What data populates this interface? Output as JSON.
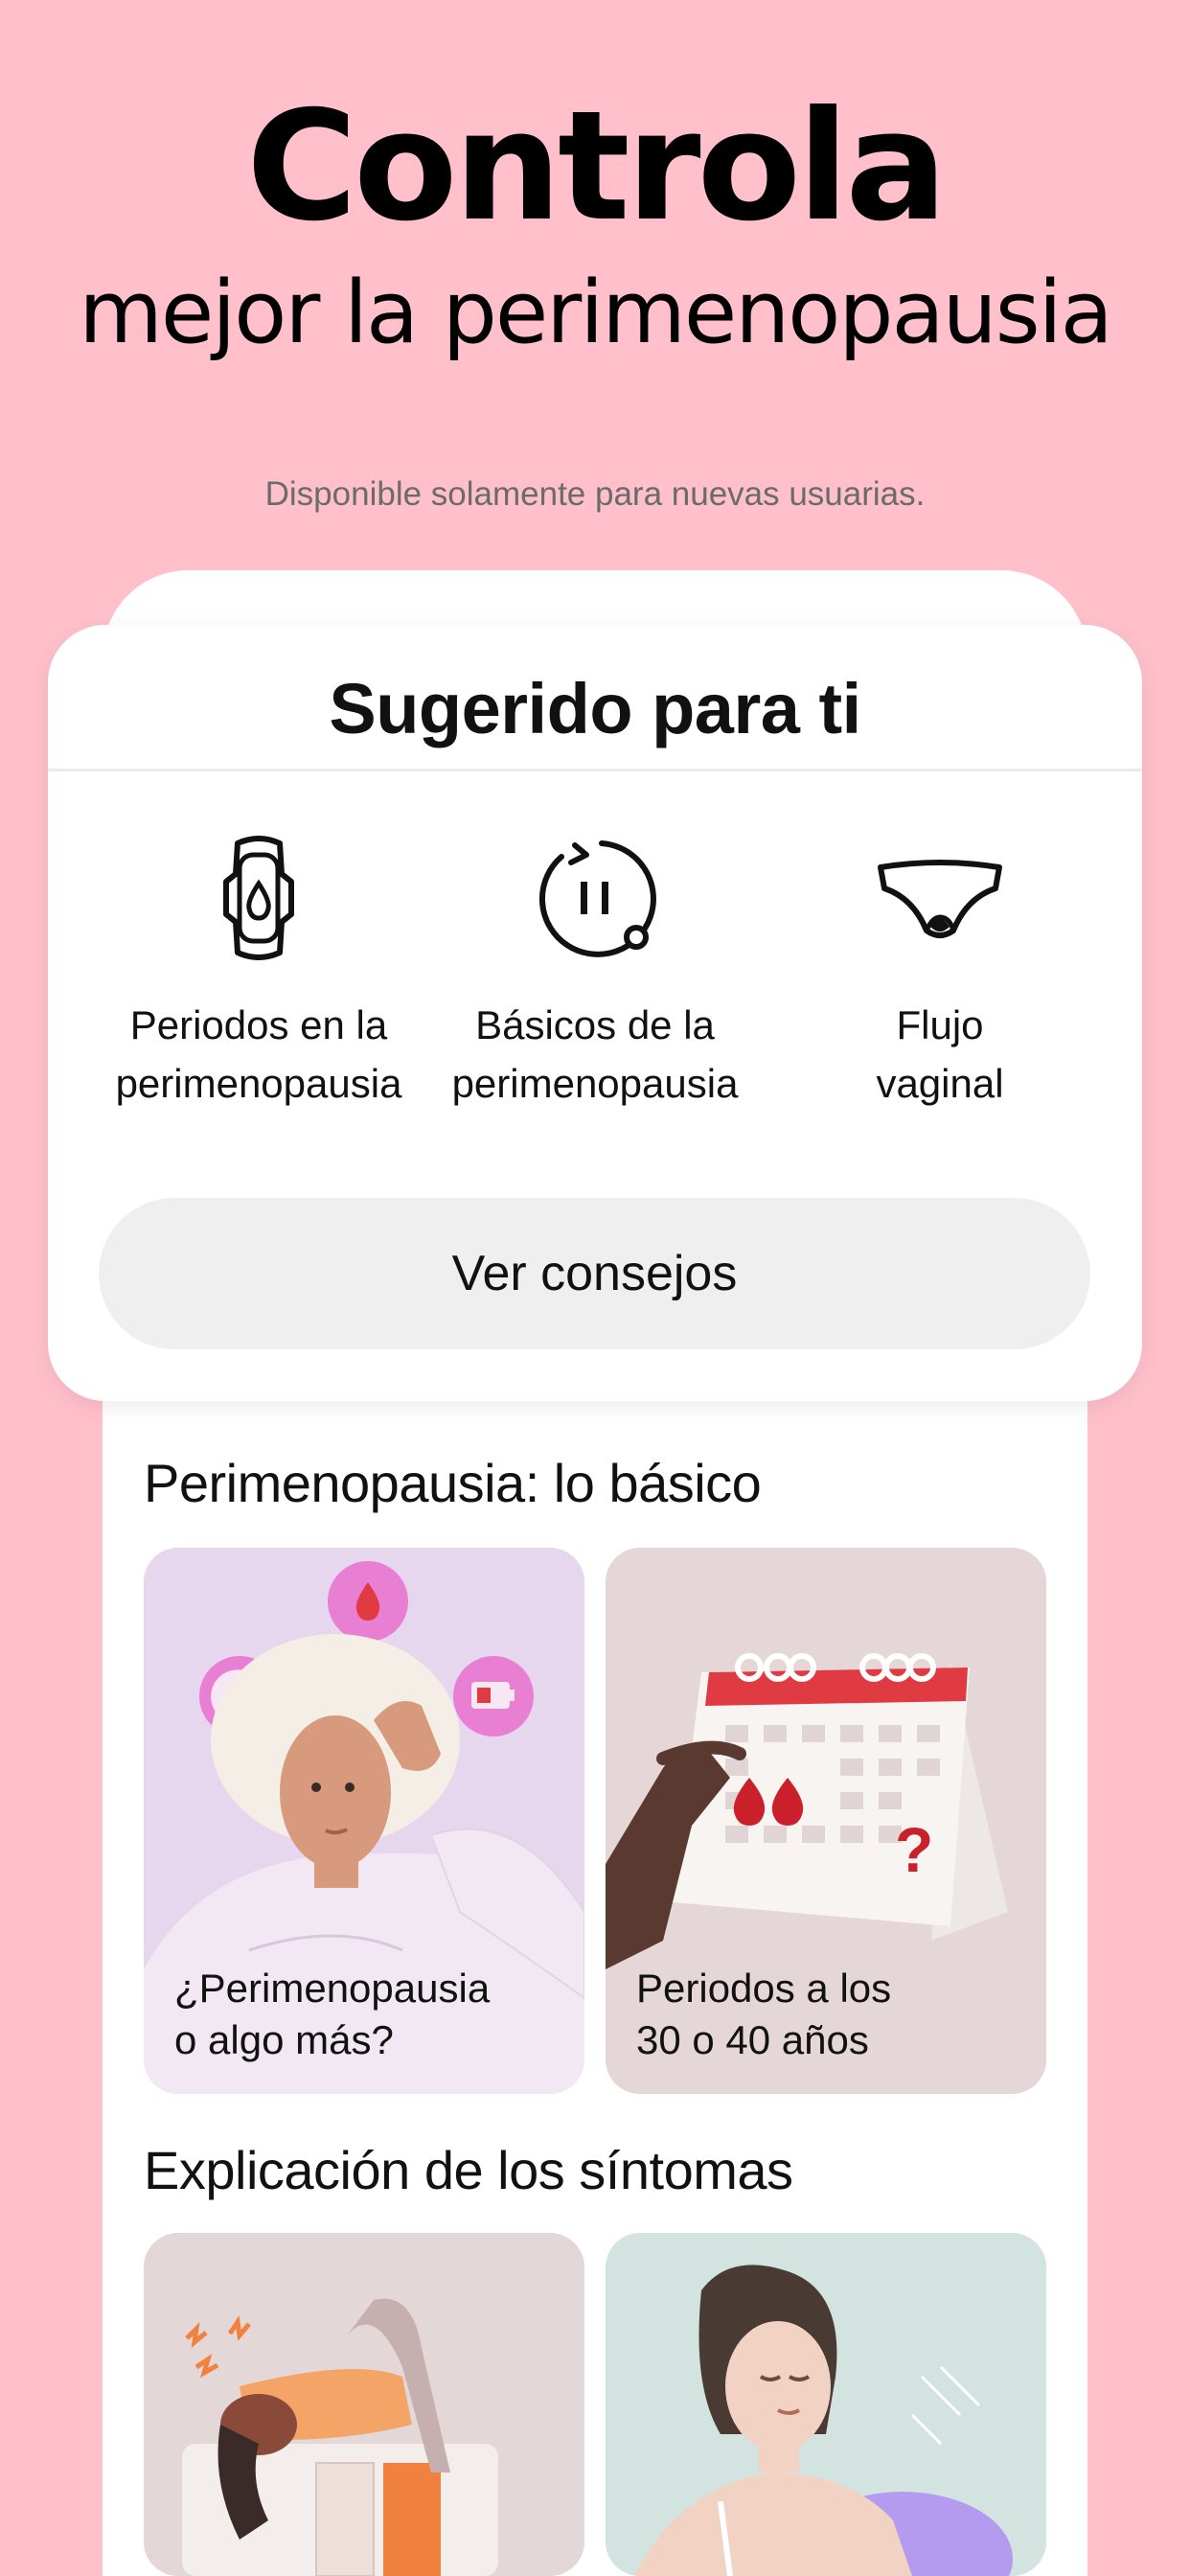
{
  "hero": {
    "title": "Controla",
    "subtitle": "mejor la perimenopausia",
    "availability": "Disponible solamente para nuevas usuarias."
  },
  "suggested": {
    "title": "Sugerido para ti",
    "topics": [
      {
        "label": "Periodos en la\nperimenopausia",
        "icon": "pad-icon"
      },
      {
        "label": "Básicos de la\nperimenopausia",
        "icon": "cycle-pause-icon"
      },
      {
        "label": "Flujo\nvaginal",
        "icon": "underwear-icon"
      }
    ],
    "button_label": "Ver consejos"
  },
  "sections": [
    {
      "title": "Perimenopausia: lo básico",
      "tiles": [
        {
          "label": "¿Perimenopausia\no algo más?",
          "bg": "#E6D7EE"
        },
        {
          "label": "Periodos a los\n30 o 40 años",
          "bg": "#E5D7D8"
        }
      ]
    },
    {
      "title": "Explicación de los síntomas",
      "tiles": [
        {
          "label": "",
          "bg": "#E4D7D7"
        },
        {
          "label": "",
          "bg": "#D3E4E0"
        }
      ]
    }
  ],
  "colors": {
    "background": "#FFC0CB",
    "accent_red": "#E03B43",
    "accent_pink": "#E87FD2"
  }
}
